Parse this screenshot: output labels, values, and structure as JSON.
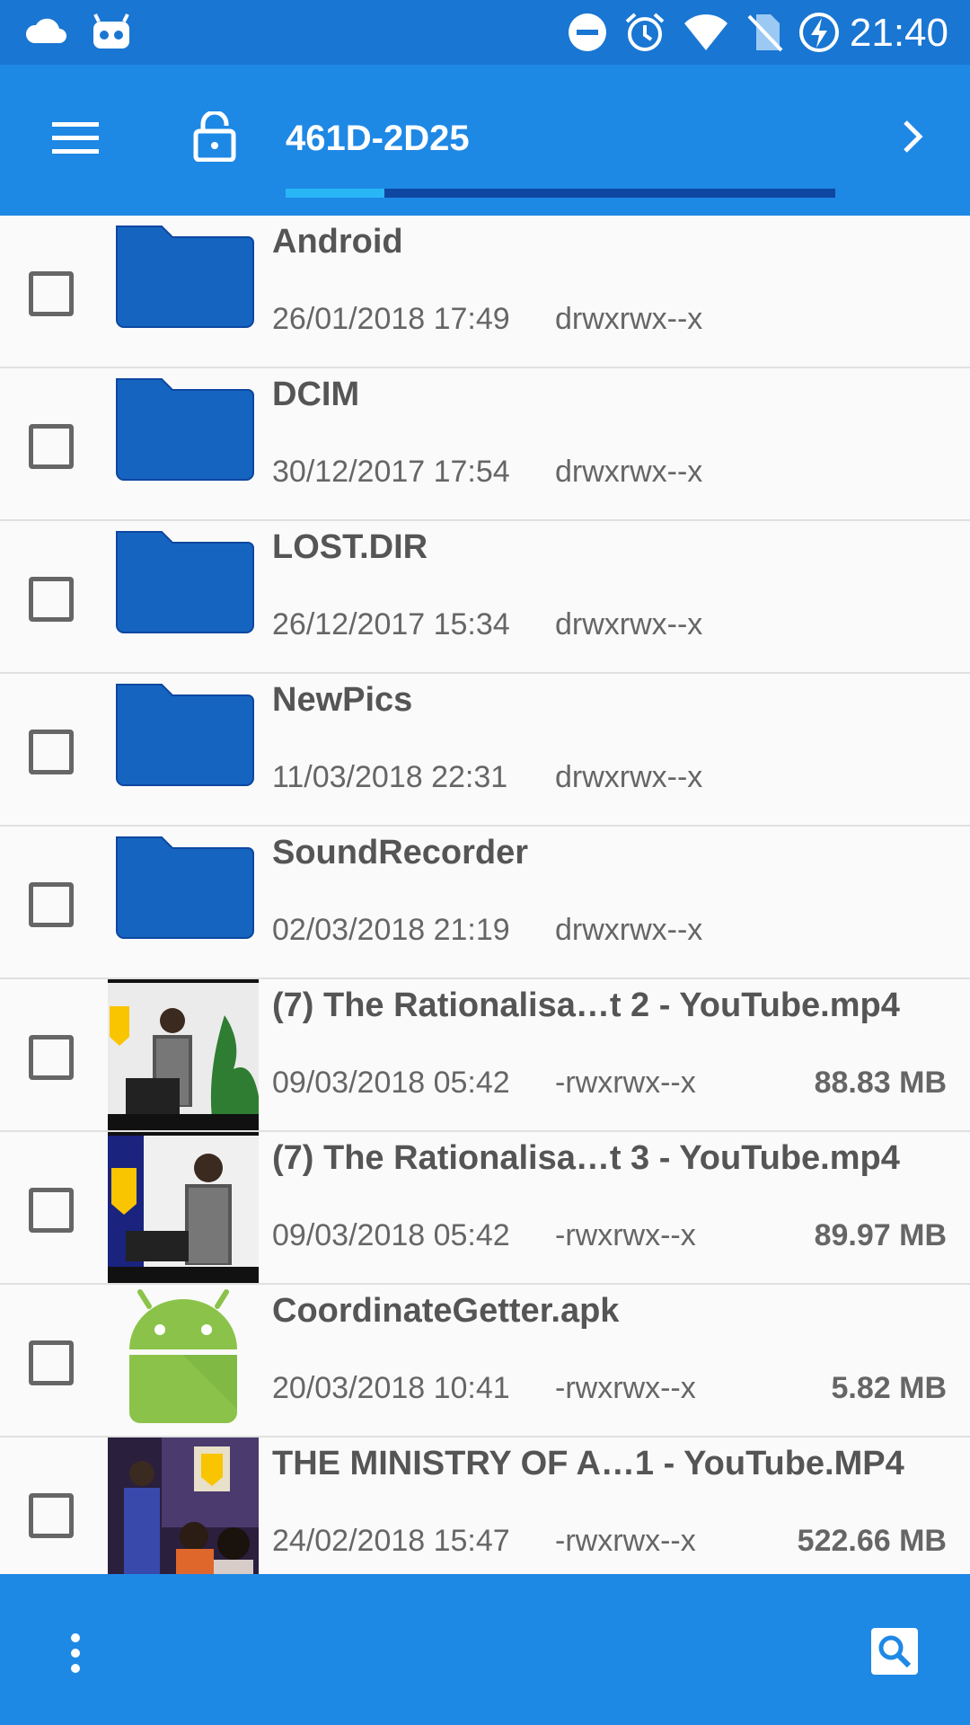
{
  "status_bar": {
    "time": "21:40",
    "icons": [
      "cloud-icon",
      "robot-icon",
      "do-not-disturb-icon",
      "alarm-icon",
      "wifi-icon",
      "no-sim-icon",
      "battery-charging-icon"
    ]
  },
  "toolbar": {
    "menu_icon": "menu-icon",
    "lock_icon": "lock-icon",
    "path": "461D-2D25",
    "path_progress": 0.18,
    "forward_icon": "chevron-right-icon"
  },
  "files": [
    {
      "name": "Android",
      "date": "26/01/2018 17:49",
      "perm": "drwxrwx--x",
      "size": "",
      "type": "folder"
    },
    {
      "name": "DCIM",
      "date": "30/12/2017 17:54",
      "perm": "drwxrwx--x",
      "size": "",
      "type": "folder"
    },
    {
      "name": "LOST.DIR",
      "date": "26/12/2017 15:34",
      "perm": "drwxrwx--x",
      "size": "",
      "type": "folder"
    },
    {
      "name": "NewPics",
      "date": "11/03/2018 22:31",
      "perm": "drwxrwx--x",
      "size": "",
      "type": "folder"
    },
    {
      "name": "SoundRecorder",
      "date": "02/03/2018 21:19",
      "perm": "drwxrwx--x",
      "size": "",
      "type": "folder"
    },
    {
      "name": "(7) The Rationalisa…t 2 - YouTube.mp4",
      "date": "09/03/2018 05:42",
      "perm": "-rwxrwx--x",
      "size": "88.83 MB",
      "type": "video1"
    },
    {
      "name": "(7) The Rationalisa…t 3 - YouTube.mp4",
      "date": "09/03/2018 05:42",
      "perm": "-rwxrwx--x",
      "size": "89.97 MB",
      "type": "video2"
    },
    {
      "name": "CoordinateGetter.apk",
      "date": "20/03/2018 10:41",
      "perm": "-rwxrwx--x",
      "size": "5.82 MB",
      "type": "apk"
    },
    {
      "name": "THE MINISTRY OF A…1 - YouTube.MP4",
      "date": "24/02/2018 15:47",
      "perm": "-rwxrwx--x",
      "size": "522.66 MB",
      "type": "video3"
    }
  ],
  "bottom_bar": {
    "more_icon": "more-vertical-icon",
    "search_icon": "search-icon"
  },
  "colors": {
    "status_bar": "#1976d2",
    "toolbar": "#1e88e5",
    "folder": "#1565c0",
    "apk": "#8bc34a"
  }
}
